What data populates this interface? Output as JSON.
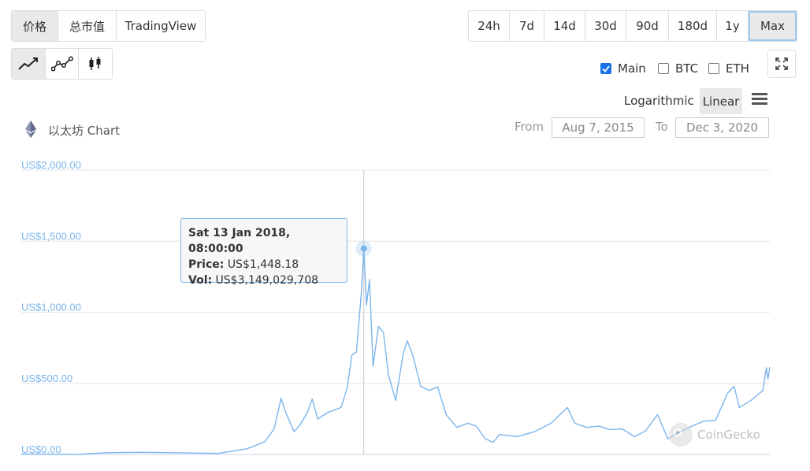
{
  "type_tabs": [
    {
      "label": "价格",
      "active": true
    },
    {
      "label": "总市值",
      "active": false
    },
    {
      "label": "TradingView",
      "active": false
    }
  ],
  "ranges": [
    {
      "label": "24h",
      "active": false
    },
    {
      "label": "7d",
      "active": false
    },
    {
      "label": "14d",
      "active": false
    },
    {
      "label": "30d",
      "active": false
    },
    {
      "label": "90d",
      "active": false
    },
    {
      "label": "180d",
      "active": false
    },
    {
      "label": "1y",
      "active": false
    },
    {
      "label": "Max",
      "active": true
    }
  ],
  "chart_styles": [
    "line-chart-icon",
    "line-dots-icon",
    "candlestick-icon"
  ],
  "series_toggles": [
    {
      "label": "Main",
      "checked": true
    },
    {
      "label": "BTC",
      "checked": false
    },
    {
      "label": "ETH",
      "checked": false
    }
  ],
  "scale": {
    "logarithmic": "Logarithmic",
    "linear": "Linear",
    "active": "linear"
  },
  "chart_header": {
    "title": "以太坊 Chart"
  },
  "date_range": {
    "from_label": "From",
    "from": "Aug 7, 2015",
    "to_label": "To",
    "to": "Dec 3, 2020"
  },
  "tooltip": {
    "date": "Sat 13 Jan 2018, 08:00:00",
    "price_label": "Price:",
    "price": "US$1,448.18",
    "vol_label": "Vol:",
    "vol": "US$3,149,029,708"
  },
  "watermark": "CoinGecko",
  "colors": {
    "line": "#7cb5ec",
    "axis_label": "#7cb5ec",
    "grid": "#e6e6e6",
    "accent": "#1a73e8"
  },
  "chart_data": {
    "type": "line",
    "title": "以太坊 Chart",
    "ylim": [
      0,
      2000
    ],
    "y_ticks": [
      "US$0.00",
      "US$500.00",
      "US$1,000.00",
      "US$1,500.00",
      "US$2,000.00"
    ],
    "y_tick_values": [
      0,
      500,
      1000,
      1500,
      2000
    ],
    "xlim": [
      "2015-08-07",
      "2020-12-03"
    ],
    "grid": true,
    "series": [
      {
        "values": [
          [
            "2015-08-07",
            3
          ],
          [
            "2016-01-01",
            1
          ],
          [
            "2016-03-15",
            12
          ],
          [
            "2016-06-15",
            15
          ],
          [
            "2016-09-01",
            12
          ],
          [
            "2017-01-01",
            8
          ],
          [
            "2017-03-15",
            40
          ],
          [
            "2017-05-01",
            90
          ],
          [
            "2017-05-25",
            180
          ],
          [
            "2017-06-12",
            395
          ],
          [
            "2017-06-25",
            290
          ],
          [
            "2017-07-16",
            160
          ],
          [
            "2017-08-01",
            210
          ],
          [
            "2017-08-20",
            300
          ],
          [
            "2017-09-01",
            390
          ],
          [
            "2017-09-15",
            250
          ],
          [
            "2017-10-15",
            300
          ],
          [
            "2017-11-15",
            330
          ],
          [
            "2017-12-01",
            470
          ],
          [
            "2017-12-13",
            700
          ],
          [
            "2017-12-25",
            720
          ],
          [
            "2018-01-07",
            1150
          ],
          [
            "2018-01-13",
            1448
          ],
          [
            "2018-01-20",
            1050
          ],
          [
            "2018-01-28",
            1230
          ],
          [
            "2018-02-06",
            620
          ],
          [
            "2018-02-20",
            900
          ],
          [
            "2018-03-05",
            860
          ],
          [
            "2018-03-18",
            560
          ],
          [
            "2018-04-06",
            380
          ],
          [
            "2018-04-25",
            700
          ],
          [
            "2018-05-06",
            800
          ],
          [
            "2018-05-20",
            700
          ],
          [
            "2018-06-10",
            480
          ],
          [
            "2018-07-01",
            450
          ],
          [
            "2018-07-24",
            475
          ],
          [
            "2018-08-15",
            280
          ],
          [
            "2018-09-12",
            190
          ],
          [
            "2018-10-10",
            220
          ],
          [
            "2018-11-01",
            200
          ],
          [
            "2018-11-25",
            110
          ],
          [
            "2018-12-15",
            85
          ],
          [
            "2019-01-01",
            140
          ],
          [
            "2019-02-15",
            125
          ],
          [
            "2019-04-01",
            160
          ],
          [
            "2019-05-15",
            220
          ],
          [
            "2019-06-26",
            330
          ],
          [
            "2019-07-15",
            220
          ],
          [
            "2019-08-15",
            190
          ],
          [
            "2019-09-15",
            200
          ],
          [
            "2019-10-15",
            175
          ],
          [
            "2019-11-15",
            180
          ],
          [
            "2019-12-17",
            125
          ],
          [
            "2020-01-15",
            165
          ],
          [
            "2020-02-15",
            280
          ],
          [
            "2020-03-13",
            110
          ],
          [
            "2020-04-15",
            160
          ],
          [
            "2020-05-15",
            200
          ],
          [
            "2020-06-15",
            235
          ],
          [
            "2020-07-15",
            240
          ],
          [
            "2020-08-15",
            430
          ],
          [
            "2020-09-01",
            480
          ],
          [
            "2020-09-15",
            330
          ],
          [
            "2020-10-15",
            380
          ],
          [
            "2020-11-15",
            450
          ],
          [
            "2020-11-24",
            610
          ],
          [
            "2020-11-28",
            530
          ],
          [
            "2020-12-03",
            615
          ]
        ]
      }
    ],
    "highlight": {
      "date": "2018-01-13",
      "value": 1448
    }
  }
}
